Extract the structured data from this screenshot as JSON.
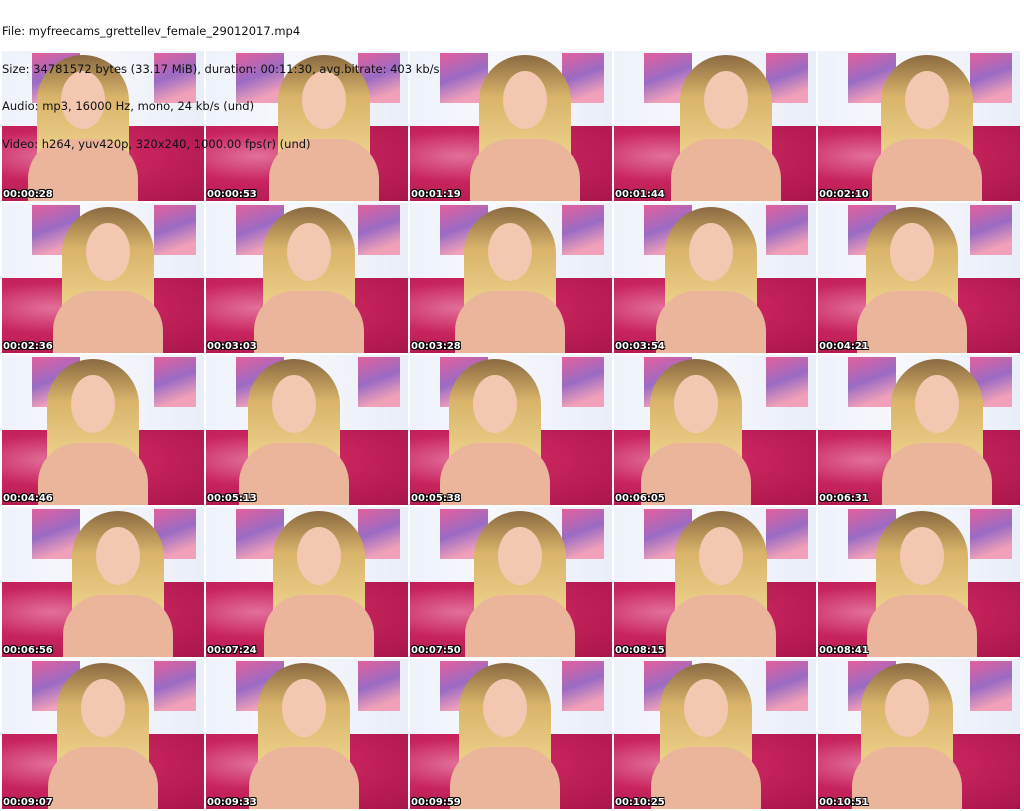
{
  "header": {
    "file": "File: myfreecams_grettellev_female_29012017.mp4",
    "size": "Size: 34781572 bytes (33.17 MiB), duration: 00:11:30, avg.bitrate: 403 kb/s",
    "audio": "Audio: mp3, 16000 Hz, mono, 24 kb/s (und)",
    "video": "Video: h264, yuv420p, 320x240, 1000.00 fps(r) (und)"
  },
  "thumbnails": [
    "00:00:28",
    "00:00:53",
    "00:01:19",
    "00:01:44",
    "00:02:10",
    "00:02:36",
    "00:03:03",
    "00:03:28",
    "00:03:54",
    "00:04:21",
    "00:04:46",
    "00:05:13",
    "00:05:38",
    "00:06:05",
    "00:06:31",
    "00:06:56",
    "00:07:24",
    "00:07:50",
    "00:08:15",
    "00:08:41",
    "00:09:07",
    "00:09:33",
    "00:09:59",
    "00:10:25",
    "00:10:51"
  ]
}
